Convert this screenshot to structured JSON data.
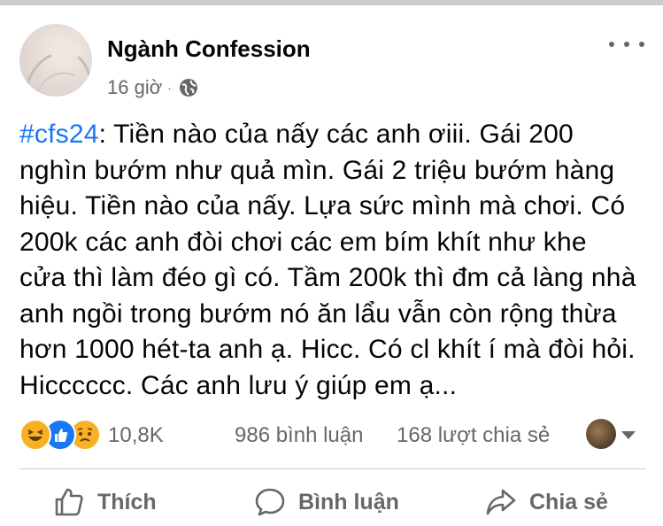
{
  "post": {
    "page_name": "Ngành Confession",
    "time": "16 giờ",
    "separator": "·",
    "privacy_icon": "globe-icon",
    "more_icon": "more-dots-icon",
    "hashtag": "#cfs24",
    "text_lines": [
      ": Tiền nào của nấy các anh ơiii. Gái 200",
      "nghìn bướm như quả mìn. Gái 2 triệu bướm hàng",
      "hiệu. Tiền nào của nấy. Lựa sức mình mà chơi. Có",
      "200k các anh đòi chơi các em bím khít như khe",
      "cửa thì làm đéo gì có. Tầm 200k thì đm cả làng nhà",
      "anh ngồi trong bướm nó ăn lẩu vẫn còn rộng thừa",
      "hơn 1000 hét-ta anh ạ. Hicc. Có cl khít í mà đòi hỏi.",
      "Hicccccc. Các anh lưu ý giúp em ạ..."
    ]
  },
  "stats": {
    "reaction_icons": [
      "haha-icon",
      "like-icon",
      "sad-icon"
    ],
    "reactions_count": "10,8K",
    "comments": "986 bình luận",
    "shares": "168 lượt chia sẻ"
  },
  "actions": {
    "like": "Thích",
    "comment": "Bình luận",
    "share": "Chia sẻ"
  },
  "colors": {
    "link": "#1877f2",
    "secondary_text": "#65676b",
    "primary_text": "#050505"
  }
}
